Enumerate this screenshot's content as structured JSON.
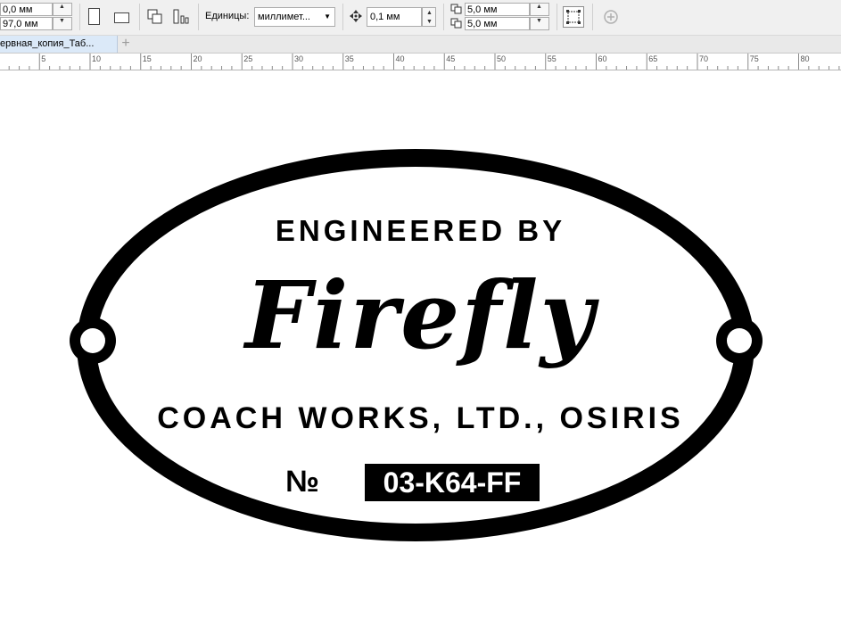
{
  "toolbar": {
    "pos_x": "0,0 мм",
    "pos_y": "97,0 мм",
    "units_label": "Единицы:",
    "units_value": "миллимет...",
    "nudge_value": "0,1 мм",
    "dup_x": "5,0 мм",
    "dup_y": "5,0 мм",
    "spin_up": "▲",
    "spin_down": "▼",
    "dropdown_arrow": "▼",
    "icons": [
      "portrait-page-icon",
      "landscape-page-icon",
      "all-pages-icon",
      "current-page-icon",
      "nudge-icon",
      "duplicate-offset-icon",
      "bleed-frame-icon",
      "add-icon"
    ]
  },
  "tabs": {
    "document_name": "ервная_копия_Таб...",
    "add_label": "+"
  },
  "ruler": {
    "labels": [
      "5",
      "10",
      "15",
      "20",
      "25",
      "30",
      "35",
      "40",
      "45",
      "50",
      "55",
      "60",
      "65",
      "70",
      "75",
      "80"
    ]
  },
  "badge": {
    "line1": "ENGINEERED BY",
    "line2": "Firefly",
    "line3": "COACH WORKS, LTD., OSIRIS",
    "number_sign": "№",
    "number": "03-K64-FF"
  }
}
